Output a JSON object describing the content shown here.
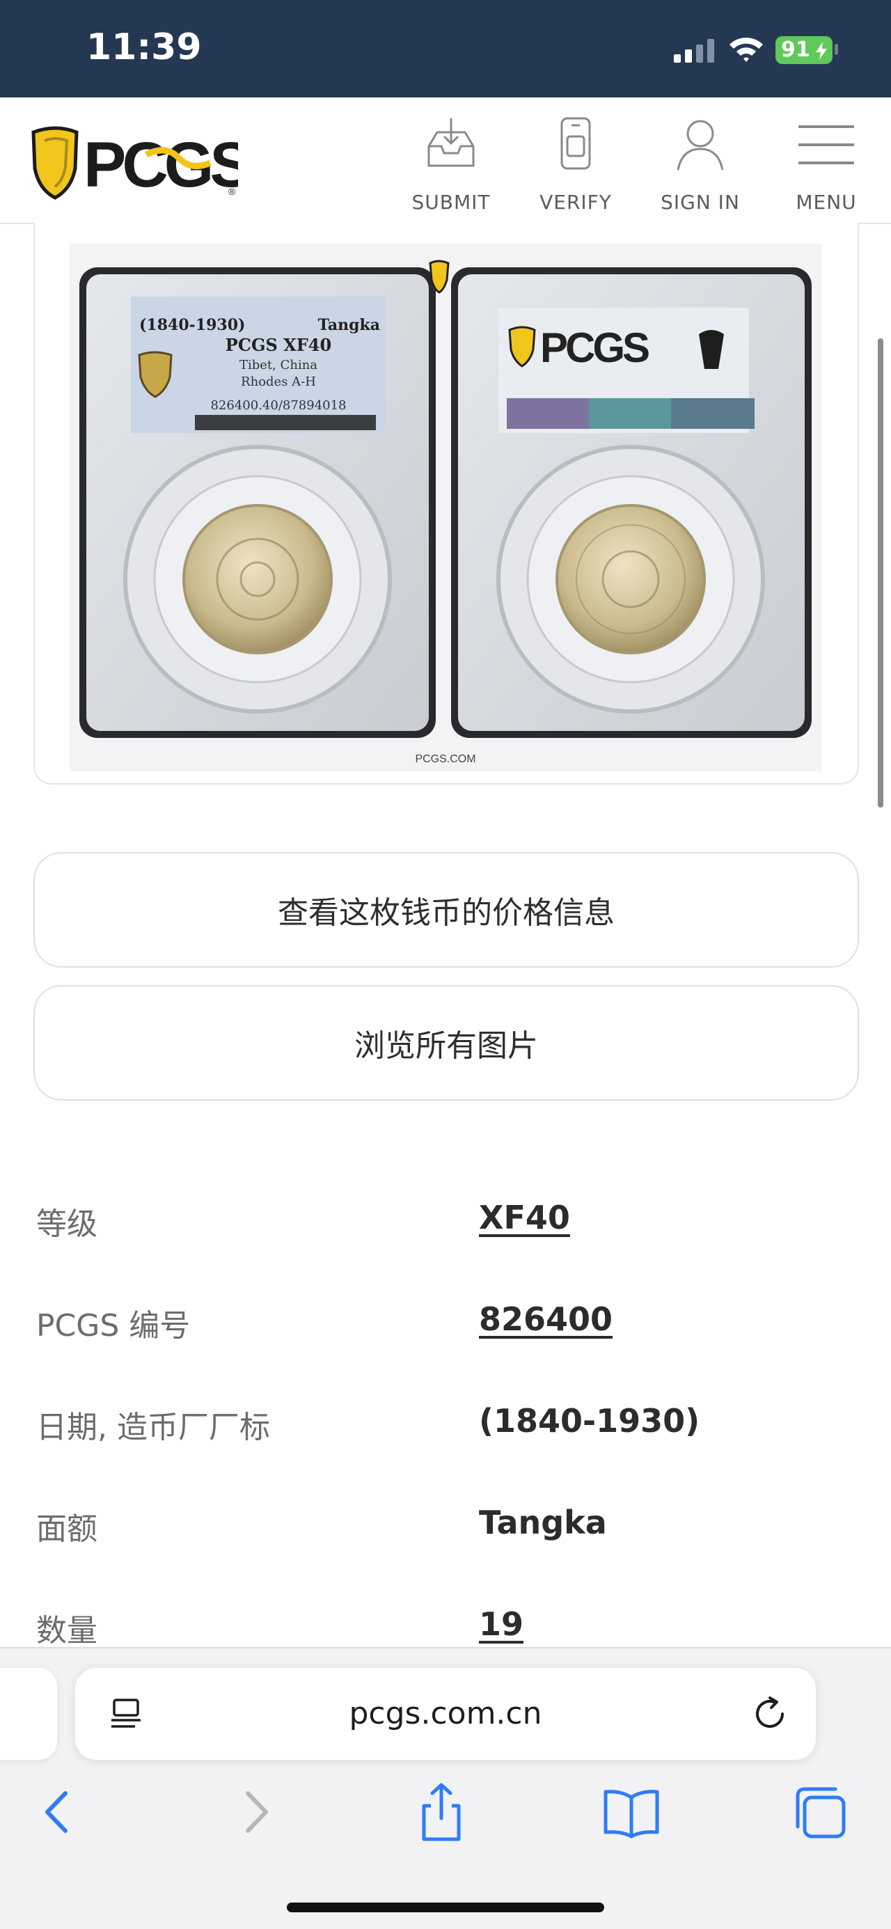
{
  "status_bar": {
    "time": "11:39",
    "battery": "91"
  },
  "header": {
    "logo_text": "PCGS",
    "nav": [
      {
        "label": "SUBMIT",
        "icon": "inbox-download-icon"
      },
      {
        "label": "VERIFY",
        "icon": "phone-verify-icon"
      },
      {
        "label": "SIGN IN",
        "icon": "user-icon"
      },
      {
        "label": "MENU",
        "icon": "hamburger-icon"
      }
    ]
  },
  "coin_image": {
    "slab_left": {
      "date": "(1840-1930)",
      "denomination": "Tangka",
      "grade_line": "PCGS XF40",
      "country": "Tibet, China",
      "variety": "Rhodes A-H",
      "cert": "826400.40/87894018"
    },
    "watermark": "PCGS.COM"
  },
  "buttons": {
    "price_info": "查看这枚钱币的价格信息",
    "all_images": "浏览所有图片"
  },
  "details": [
    {
      "label": "等级",
      "value": "XF40"
    },
    {
      "label": "PCGS 编号",
      "value": "826400"
    },
    {
      "label": "日期, 造币厂厂标",
      "value": "(1840-1930)"
    },
    {
      "label": "面额",
      "value": "Tangka"
    },
    {
      "label": "数量",
      "value": "19"
    }
  ],
  "browser": {
    "url": "pcgs.com.cn"
  },
  "colors": {
    "status_bar": "#253853",
    "logo_yellow": "#f2c51c",
    "battery": "#5fc95b"
  }
}
